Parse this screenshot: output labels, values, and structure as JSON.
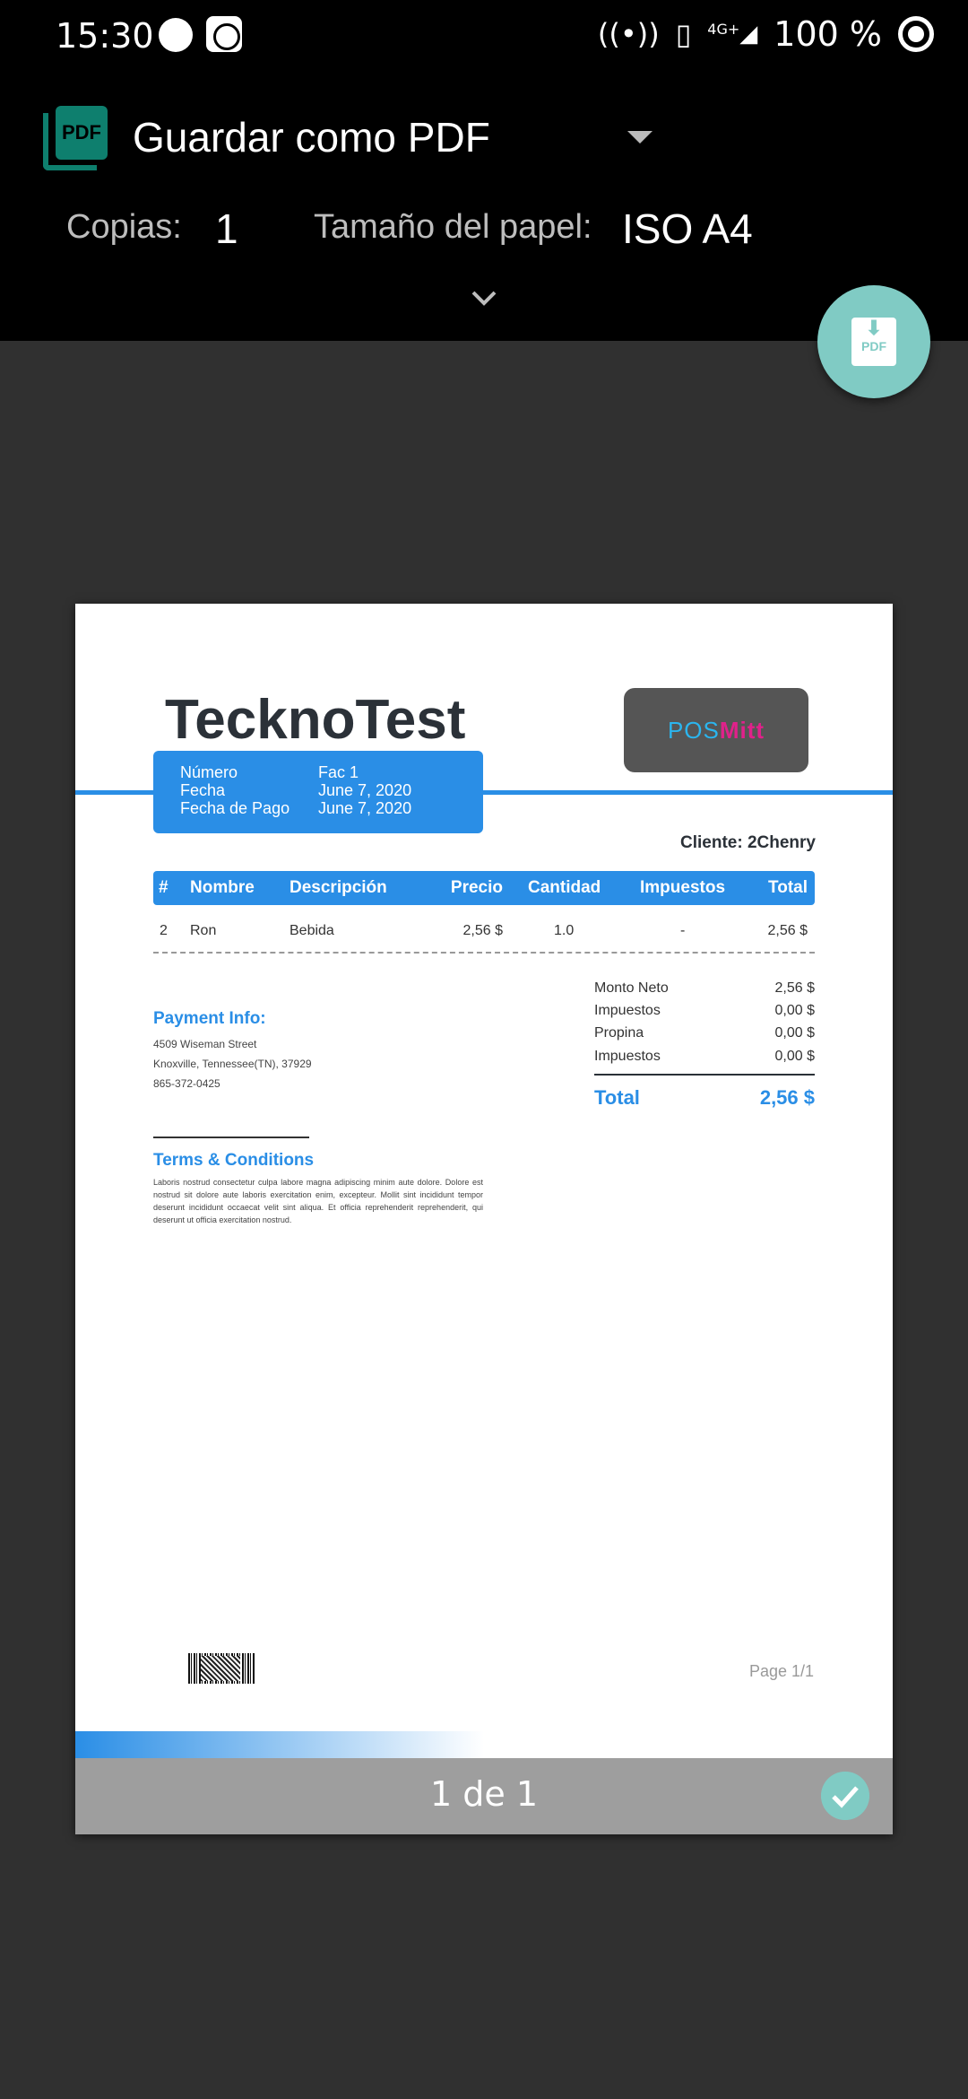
{
  "status_bar": {
    "time": "15:30",
    "battery": "100 %",
    "network": "4G+"
  },
  "header": {
    "printer_name": "Guardar como PDF",
    "copies_label": "Copias:",
    "copies_value": "1",
    "paper_label": "Tamaño del papel:",
    "paper_value": "ISO A4"
  },
  "fab": {
    "label": "PDF"
  },
  "document": {
    "company": "TecknoTest",
    "logo": {
      "part1": "POS",
      "part2": "Mitt"
    },
    "info": [
      {
        "key": "Número",
        "value": "Fac 1"
      },
      {
        "key": "Fecha",
        "value": "June 7, 2020"
      },
      {
        "key": "Fecha de Pago",
        "value": "June 7, 2020"
      }
    ],
    "client": "Cliente: 2Chenry",
    "table": {
      "headers": [
        "#",
        "Nombre",
        "Descripción",
        "Precio",
        "Cantidad",
        "Impuestos",
        "Total"
      ],
      "rows": [
        [
          "2",
          "Ron",
          "Bebida",
          "2,56 $",
          "1.0",
          "-",
          "2,56 $"
        ]
      ]
    },
    "payment": {
      "title": "Payment Info:",
      "lines": [
        "4509 Wiseman Street",
        "Knoxville, Tennessee(TN), 37929",
        "865-372-0425"
      ]
    },
    "summary": [
      {
        "label": "Monto Neto",
        "value": "2,56 $"
      },
      {
        "label": "Impuestos",
        "value": "0,00 $"
      },
      {
        "label": "Propina",
        "value": "0,00 $"
      },
      {
        "label": "Impuestos",
        "value": "0,00 $"
      }
    ],
    "total": {
      "label": "Total",
      "value": "2,56 $"
    },
    "terms": {
      "title": "Terms & Conditions",
      "text": "Laboris nostrud consectetur culpa labore magna adipiscing minim aute dolore. Dolore est nostrud sit dolore aute laboris exercitation enim, excepteur. Mollit sint incididunt tempor deserunt incididunt occaecat velit sint aliqua. Et officia reprehenderit reprehenderit, qui deserunt ut officia exercitation nostrud."
    },
    "page_number": "Page 1/1"
  },
  "pager": {
    "text": "1 de 1"
  },
  "colors": {
    "accent_blue": "#2a8ee6",
    "teal_fab": "#80cbc4",
    "pdf_icon": "#0e7f6e"
  }
}
